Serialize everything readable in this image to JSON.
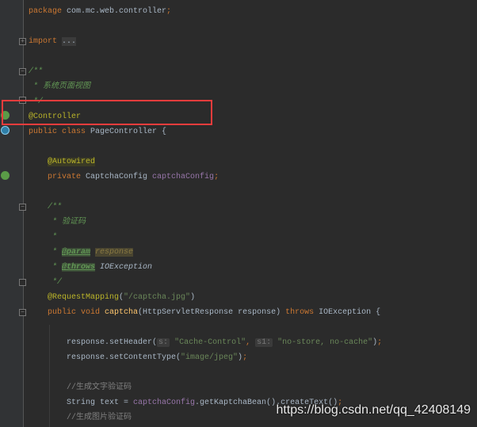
{
  "editor": {
    "lines": [
      [
        [
          "package ",
          "kw"
        ],
        [
          "com.mc.web.controller",
          ""
        ],
        [
          ";",
          "kw"
        ]
      ],
      [],
      [
        [
          "import ",
          "kw"
        ],
        [
          "...",
          "fold"
        ]
      ],
      [],
      [
        [
          "/**",
          "doc"
        ]
      ],
      [
        [
          " * 系统页面视图",
          "doc"
        ]
      ],
      [
        [
          " */",
          "doc"
        ]
      ],
      [
        [
          "@Controller",
          "ann"
        ]
      ],
      [
        [
          "public class ",
          "kw"
        ],
        [
          "PageController {",
          ""
        ]
      ],
      [],
      [
        [
          "    ",
          ""
        ],
        [
          "@Autowired",
          "ann-hl"
        ]
      ],
      [
        [
          "    ",
          ""
        ],
        [
          "private ",
          "kw"
        ],
        [
          "CaptchaConfig ",
          ""
        ],
        [
          "captchaConfig",
          "fld"
        ],
        [
          ";",
          "kw"
        ]
      ],
      [],
      [
        [
          "    ",
          ""
        ],
        [
          "/**",
          "doc"
        ]
      ],
      [
        [
          "     * 验证码",
          "doc"
        ]
      ],
      [
        [
          "     *",
          "doc"
        ]
      ],
      [
        [
          "     * ",
          "doc"
        ],
        [
          "@param",
          "doctag"
        ],
        [
          " ",
          ""
        ],
        [
          "response",
          "docparam"
        ]
      ],
      [
        [
          "     * ",
          "doc"
        ],
        [
          "@throws",
          "doctag"
        ],
        [
          " IOException",
          "docref"
        ]
      ],
      [
        [
          "     */",
          "doc"
        ]
      ],
      [
        [
          "    ",
          ""
        ],
        [
          "@RequestMapping",
          "ann"
        ],
        [
          "(",
          ""
        ],
        [
          "\"/captcha.jpg\"",
          "str"
        ],
        [
          ")",
          ""
        ]
      ],
      [
        [
          "    ",
          ""
        ],
        [
          "public void ",
          "kw"
        ],
        [
          "captcha",
          "mth"
        ],
        [
          "(HttpServletResponse response) ",
          ""
        ],
        [
          "throws ",
          "kw"
        ],
        [
          "IOException {",
          ""
        ]
      ],
      [],
      [
        [
          "        response.setHeader(",
          ""
        ],
        [
          "s:",
          "hint"
        ],
        [
          " ",
          ""
        ],
        [
          "\"Cache-Control\"",
          "str"
        ],
        [
          ", ",
          "kw"
        ],
        [
          "s1:",
          "hint"
        ],
        [
          " ",
          ""
        ],
        [
          "\"no-store, no-cache\"",
          "str"
        ],
        [
          ")",
          ""
        ],
        [
          ";",
          "kw"
        ]
      ],
      [
        [
          "        response.setContentType(",
          ""
        ],
        [
          "\"image/jpeg\"",
          "str"
        ],
        [
          ")",
          ""
        ],
        [
          ";",
          "kw"
        ]
      ],
      [],
      [
        [
          "        //生成文字验证码",
          "cmt"
        ]
      ],
      [
        [
          "        String text = ",
          ""
        ],
        [
          "captchaConfig",
          "fld"
        ],
        [
          ".getKaptchaBean().createText()",
          ""
        ],
        [
          ";",
          "kw"
        ]
      ],
      [
        [
          "        //生成图片验证码",
          "cmt"
        ]
      ]
    ]
  },
  "gutter_icons": {
    "controller_line": "spring-bean-icon",
    "class_line": "class-icon",
    "autowired_line": "autowired-navigate-icon"
  },
  "highlight": {
    "color": "#f03c3c",
    "target": "@Controller"
  },
  "watermark": "https://blog.csdn.net/qq_42408149"
}
